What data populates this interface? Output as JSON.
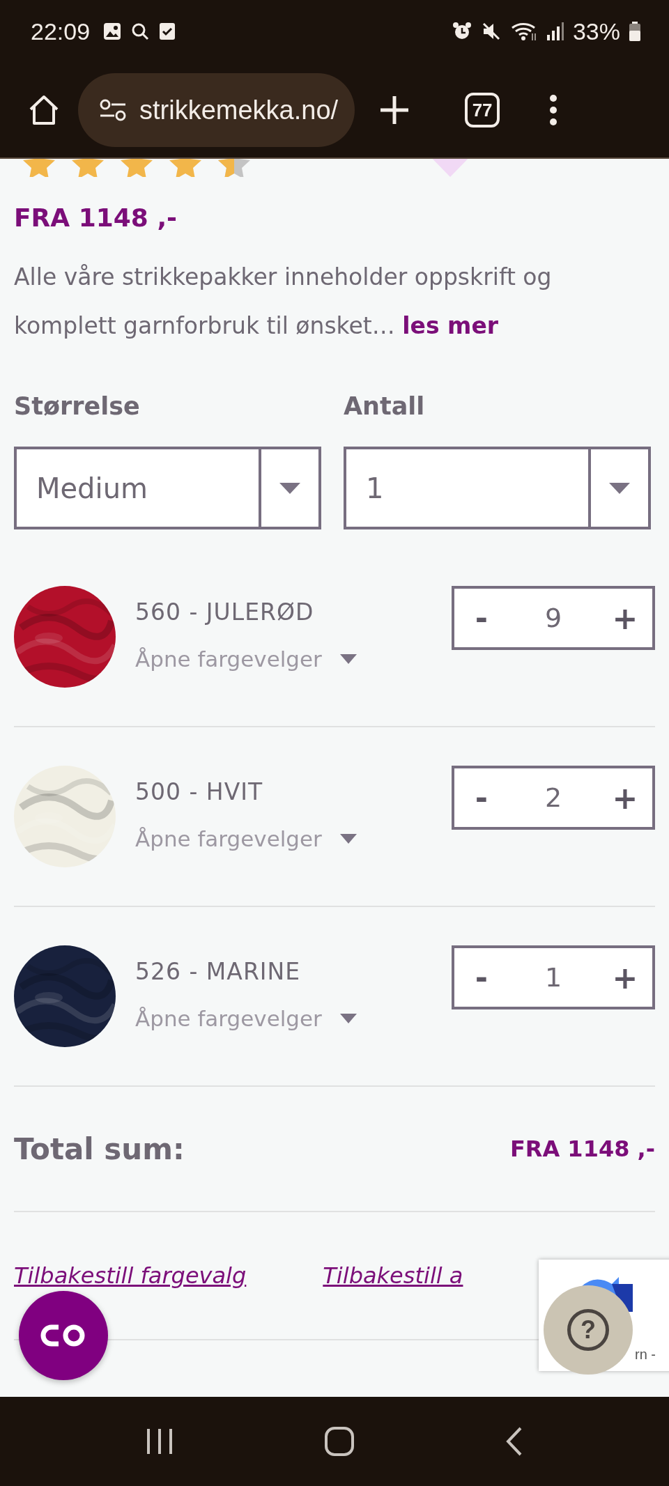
{
  "status_bar": {
    "time": "22:09",
    "battery": "33%"
  },
  "browser": {
    "url": "strikkemekka.no/",
    "tab_count": "77"
  },
  "product": {
    "price": "FRA 1148 ,-",
    "description": "Alle våre strikkepakker inneholder oppskrift og komplett garnforbruk til ønsket…",
    "read_more": "les mer"
  },
  "options": [
    {
      "label": "Størrelse",
      "value": "Medium"
    },
    {
      "label": "Antall",
      "value": "1"
    }
  ],
  "colors": [
    {
      "name": "560 - JULERØD",
      "picker": "Åpne fargevelger",
      "color": "#b3102a",
      "minus": "-",
      "quantity": "9",
      "plus": "+"
    },
    {
      "name": "500 - HVIT",
      "picker": "Åpne fargevelger",
      "color": "#f1efe4",
      "minus": "-",
      "quantity": "2",
      "plus": "+"
    },
    {
      "name": "526 - MARINE",
      "picker": "Åpne fargevelger",
      "color": "#18213d",
      "minus": "-",
      "quantity": "1",
      "plus": "+"
    }
  ],
  "total": {
    "label": "Total sum:",
    "value": "FRA 1148 ,-"
  },
  "links": [
    "Tilbakestill fargevalg",
    "Tilbakestill a"
  ],
  "help_button": "?",
  "recaptcha": {
    "text": "rn -"
  }
}
